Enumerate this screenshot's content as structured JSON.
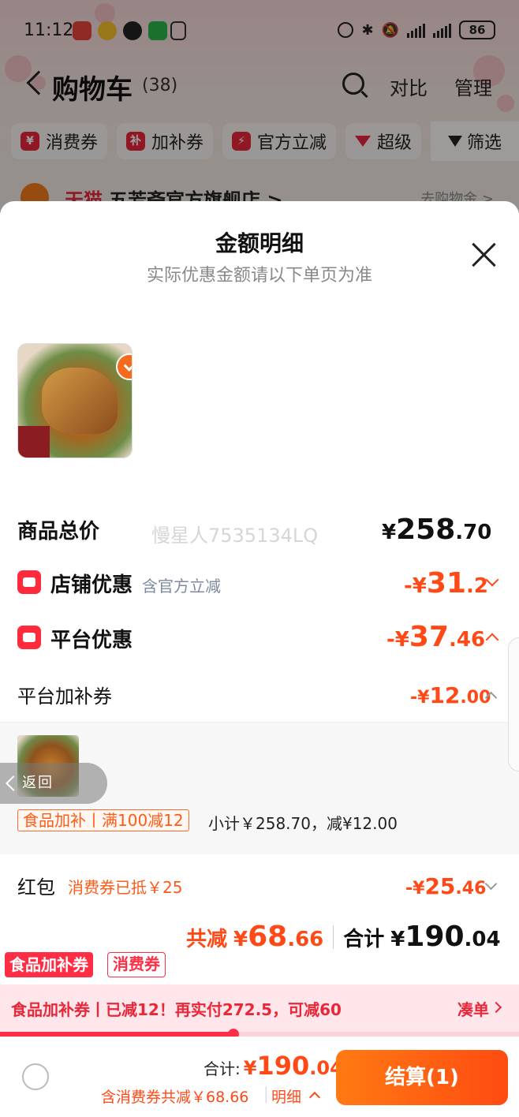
{
  "status_bar": {
    "time": "11:12",
    "battery": "86"
  },
  "nav": {
    "title": "购物车",
    "count": "(38)",
    "compare": "对比",
    "manage": "管理"
  },
  "chips": [
    {
      "icon_text": "¥",
      "label": "消费券"
    },
    {
      "icon_text": "补",
      "label": "加补券"
    },
    {
      "icon_text": "⚡",
      "label": "官方立减"
    },
    {
      "icon_text": "",
      "label": "超级"
    }
  ],
  "filter_label": "筛选",
  "store": {
    "brand": "天猫",
    "name": "五芳斋官方旗舰店 >",
    "link": "去购物金 >"
  },
  "sheet": {
    "title": "金额明细",
    "subtitle": "实际优惠金额请以下单页为准",
    "watermark": "慢星人7535134LQ",
    "goods_total": {
      "label": "商品总价",
      "yen": "¥",
      "int": "258",
      "dec": ".70"
    },
    "store_discount": {
      "label": "店铺优惠",
      "note": "含官方立减",
      "yen": "-¥",
      "int": "31",
      "dec": ".2"
    },
    "platform_discount": {
      "label": "平台优惠",
      "yen": "-¥",
      "int": "37",
      "dec": ".46"
    },
    "platform_coupon": {
      "label": "平台加补券",
      "yen": "-¥",
      "int": "12",
      "dec": ".00"
    },
    "coupon_detail": {
      "tag": "食品加补丨满100减12",
      "subtotal": "小计￥258.70，减¥12.00"
    },
    "back_label": "返回",
    "red_packet": {
      "label": "红包",
      "note": "消费券已抵￥25",
      "yen": "-¥",
      "int": "25",
      "dec": ".46"
    },
    "total_reduce": {
      "label": "共减",
      "yen": "¥",
      "int": "68",
      "dec": ".66"
    },
    "total_sum": {
      "label": "合计",
      "yen": "¥",
      "int": "190",
      "dec": ".04"
    }
  },
  "tags": {
    "food": "食品加补券",
    "consume": "消费券"
  },
  "promo": {
    "text": "食品加补券丨已减12！再实付272.5，可减60",
    "action": "凑单",
    "progress": 0.45
  },
  "checkout": {
    "total_label": "合计:",
    "yen": "¥",
    "int": "190",
    "dec": ".04",
    "note": "含消费券共减￥68.66",
    "detail": "明细",
    "button": "结算(1)"
  },
  "colors": {
    "accent": "#ff4a17",
    "brand_red": "#e8283a",
    "checkout": "#ff5a12"
  }
}
